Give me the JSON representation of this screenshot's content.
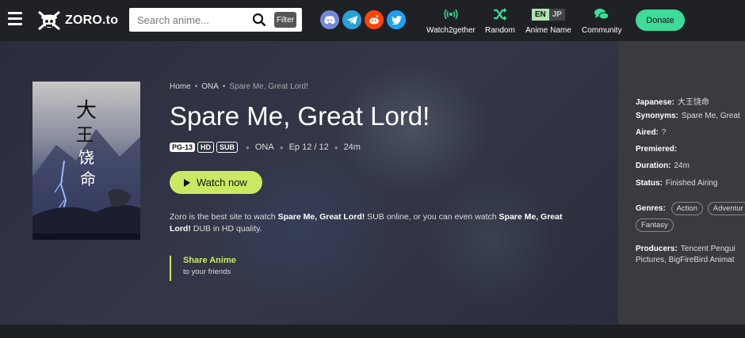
{
  "header": {
    "logo_text": "ZORO.to",
    "search_placeholder": "Search anime...",
    "filter_label": "Filter",
    "social": [
      {
        "name": "discord",
        "color": "#7289da"
      },
      {
        "name": "telegram",
        "color": "#2aa0da"
      },
      {
        "name": "reddit",
        "color": "#ff4500"
      },
      {
        "name": "twitter",
        "color": "#1da1f2"
      }
    ],
    "nav": [
      {
        "label": "Watch2gether",
        "icon": "broadcast-icon"
      },
      {
        "label": "Random",
        "icon": "shuffle-icon"
      },
      {
        "label": "Anime Name",
        "icon": "language-toggle"
      },
      {
        "label": "Community",
        "icon": "chat-icon"
      }
    ],
    "lang_en": "EN",
    "lang_jp": "JP",
    "donate_label": "Donate"
  },
  "breadcrumb": {
    "home": "Home",
    "type": "ONA",
    "current": "Spare Me, Great Lord!"
  },
  "anime": {
    "title": "Spare Me, Great Lord!",
    "rating": "PG-13",
    "quality": "HD",
    "audio": "SUB",
    "type": "ONA",
    "episodes": "Ep 12 / 12",
    "duration": "24m",
    "watch_label": "Watch now",
    "desc_intro": "Zoro is the best site to watch ",
    "desc_title1": "Spare Me, Great Lord!",
    "desc_mid": " SUB online, or you can even watch ",
    "desc_title2": "Spare Me, Great Lord!",
    "desc_end": " DUB in HD quality.",
    "share_title": "Share Anime",
    "share_sub": "to your friends",
    "poster_title": "大王饶命"
  },
  "info": {
    "japanese_label": "Japanese:",
    "japanese_value": "大王饶命",
    "synonyms_label": "Synonyms:",
    "synonyms_value": "Spare Me, Great",
    "aired_label": "Aired:",
    "aired_value": "?",
    "premiered_label": "Premiered:",
    "premiered_value": "",
    "duration_label": "Duration:",
    "duration_value": "24m",
    "status_label": "Status:",
    "status_value": "Finished Airing",
    "genres_label": "Genres:",
    "genres": [
      "Action",
      "Adventur",
      "Fantasy"
    ],
    "producers_label": "Producers:",
    "producers_line1": "Tencent Pengui",
    "producers_line2": "Pictures, BigFireBird Animat"
  },
  "colors": {
    "accent": "#cae962",
    "donate": "#3ddc97"
  }
}
